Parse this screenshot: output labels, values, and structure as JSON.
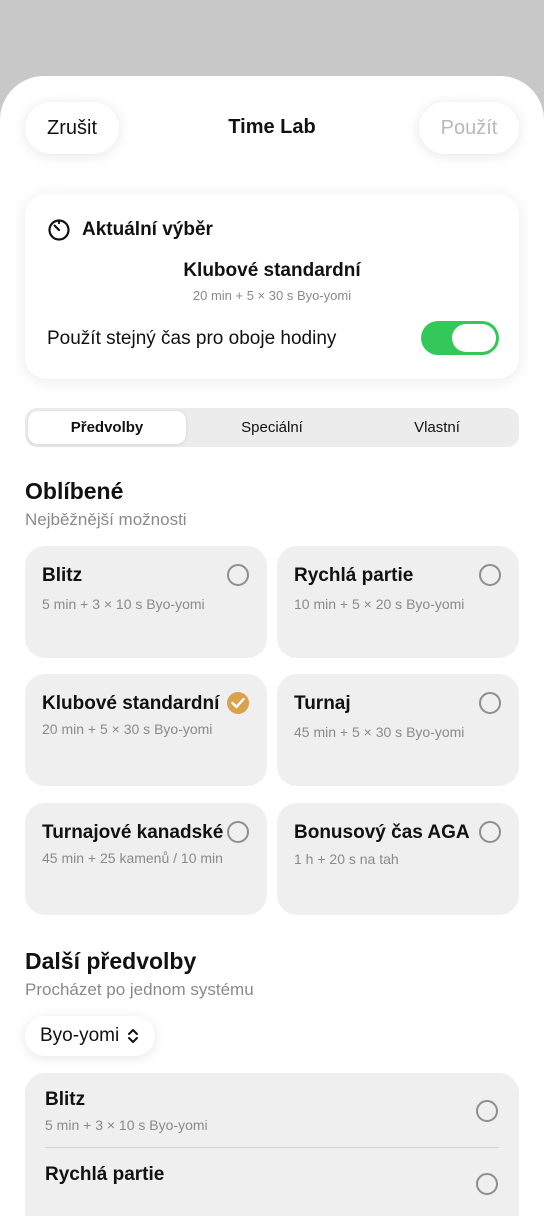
{
  "header": {
    "cancel_label": "Zrušit",
    "title": "Time Lab",
    "apply_label": "Použít"
  },
  "current": {
    "heading": "Aktuální výběr",
    "name": "Klubové standardní",
    "detail": "20 min + 5 × 30 s Byo-yomi",
    "same_time_label": "Použít stejný čas pro oboje hodiny",
    "same_time_on": true
  },
  "tabs": [
    "Předvolby",
    "Speciální",
    "Vlastní"
  ],
  "favorites": {
    "title": "Oblíbené",
    "subtitle": "Nejběžnější možnosti",
    "items": [
      {
        "name": "Blitz",
        "detail": "5 min + 3 × 10 s Byo-yomi",
        "selected": false
      },
      {
        "name": "Rychlá partie",
        "detail": "10 min + 5 × 20 s Byo-yomi",
        "selected": false
      },
      {
        "name": "Klubové standardní",
        "detail": "20 min + 5 × 30 s Byo-yomi",
        "selected": true
      },
      {
        "name": "Turnaj",
        "detail": "45 min + 5 × 30 s Byo-yomi",
        "selected": false
      },
      {
        "name": "Turnajové kanadské",
        "detail": "45 min + 25 kamenů / 10 min",
        "selected": false
      },
      {
        "name": "Bonusový čas AGA",
        "detail": "1 h + 20 s na tah",
        "selected": false
      }
    ]
  },
  "more": {
    "title": "Další předvolby",
    "subtitle": "Procházet po jednom systému",
    "system_selected": "Byo-yomi",
    "items": [
      {
        "name": "Blitz",
        "detail": "5 min + 3 × 10 s Byo-yomi"
      },
      {
        "name": "Rychlá partie",
        "detail": ""
      }
    ]
  },
  "colors": {
    "toggle_on": "#34c759",
    "selected_check": "#d9a24e"
  }
}
